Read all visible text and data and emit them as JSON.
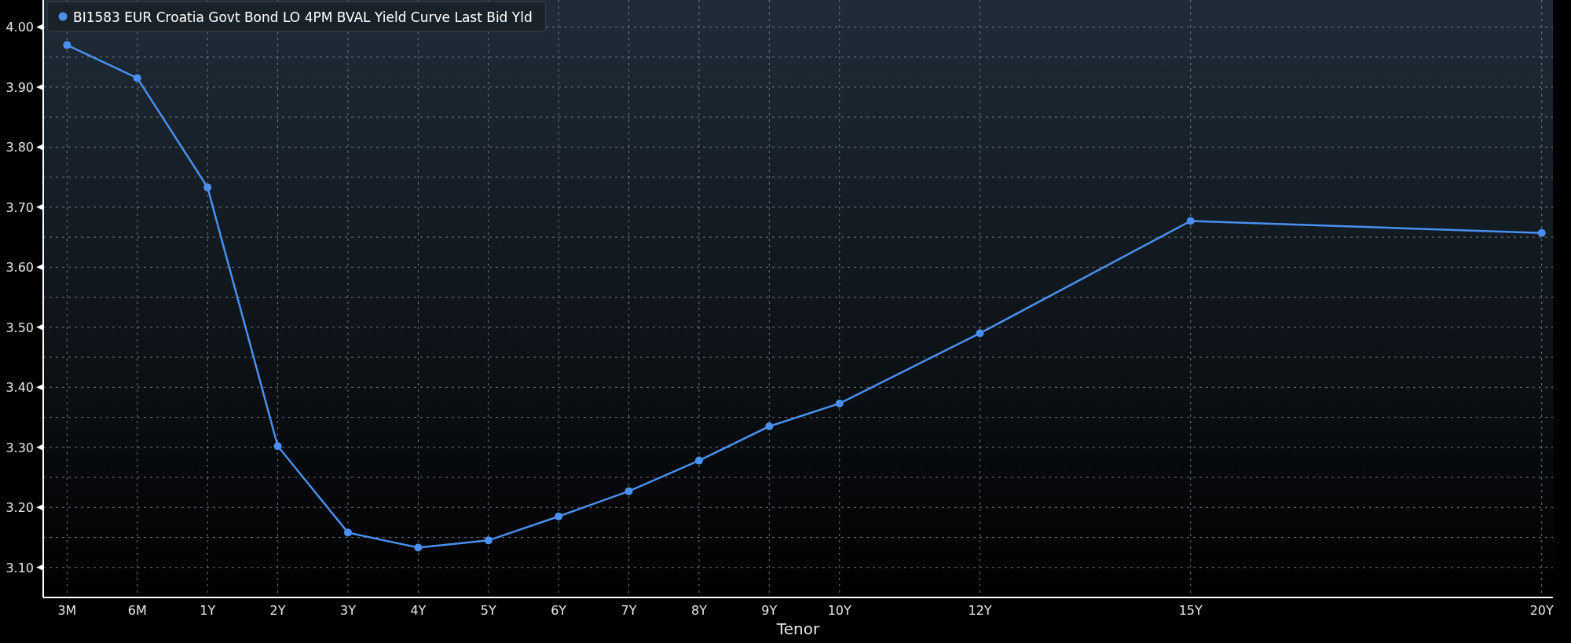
{
  "chart": {
    "chart_data": {
      "type": "line",
      "xlabel": "Tenor",
      "grid": true,
      "categories": [
        "3M",
        "6M",
        "1Y",
        "2Y",
        "3Y",
        "4Y",
        "5Y",
        "6Y",
        "7Y",
        "8Y",
        "9Y",
        "10Y",
        null,
        "12Y",
        null,
        null,
        "15Y",
        null,
        null,
        null,
        null,
        "20Y"
      ],
      "series": [
        {
          "name": "BI1583 EUR Croatia Govt Bond LO 4PM BVAL Yield Curve Last Bid Yld",
          "color": "#4a90f0",
          "marker": "circle",
          "values": [
            3.97,
            3.915,
            3.733,
            3.302,
            3.158,
            3.133,
            3.145,
            3.185,
            3.227,
            3.278,
            3.335,
            3.373,
            null,
            3.49,
            null,
            null,
            3.677,
            null,
            null,
            null,
            null,
            3.657
          ]
        }
      ],
      "ylim": [
        3.05,
        4.045
      ],
      "yticks": [
        {
          "value": 3.1,
          "label": "3.10"
        },
        {
          "value": 3.2,
          "label": "3.20"
        },
        {
          "value": 3.3,
          "label": "3.30"
        },
        {
          "value": 3.4,
          "label": "3.40"
        },
        {
          "value": 3.5,
          "label": "3.50"
        },
        {
          "value": 3.6,
          "label": "3.60"
        },
        {
          "value": 3.7,
          "label": "3.70"
        },
        {
          "value": 3.8,
          "label": "3.80"
        },
        {
          "value": 3.9,
          "label": "3.90"
        },
        {
          "value": 4.0,
          "label": "4.00"
        }
      ]
    }
  }
}
